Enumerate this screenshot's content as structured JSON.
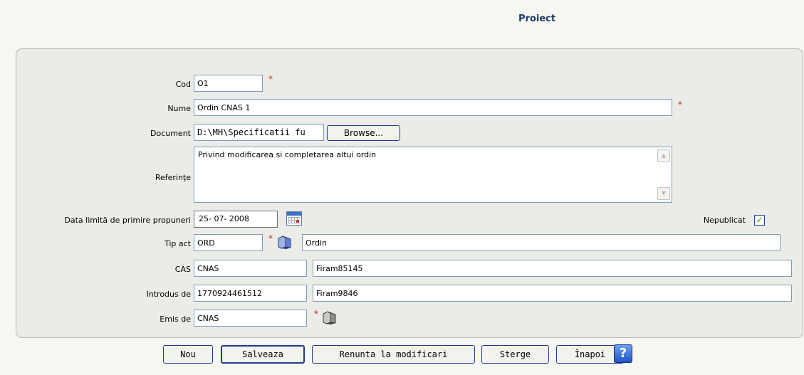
{
  "page": {
    "title": "Proiect"
  },
  "form": {
    "cod": {
      "label": "Cod",
      "value": "O1"
    },
    "nume": {
      "label": "Nume",
      "value": "Ordin CNAS 1"
    },
    "document": {
      "label": "Document",
      "value": "D:\\MH\\Specificatii fu",
      "browse_label": "Browse..."
    },
    "referinte": {
      "label": "Referinţe",
      "value": "Privind modificarea si completarea altui ordin"
    },
    "data_limita": {
      "label": "Data limită de primire propuneri",
      "value": "25- 07-  2008"
    },
    "nepublicat": {
      "label": "Nepublicat",
      "checked": true,
      "check_mark": "✓"
    },
    "tip_act": {
      "label": "Tip act",
      "code": "ORD",
      "name": "Ordin"
    },
    "cas": {
      "label": "CAS",
      "code": "CNAS",
      "name": "Firam85145"
    },
    "introdus_de": {
      "label": "Introdus de",
      "code": "1770924461512",
      "name": "Firam9846"
    },
    "emis_de": {
      "label": "Emis de",
      "code": "CNAS"
    },
    "required_marker": "*"
  },
  "buttons": {
    "nou": "Nou",
    "salveaza": "Salveaza",
    "renunta": "Renunta la modificari",
    "sterge": "Sterge",
    "inapoi": "Înapoi",
    "help": "?"
  },
  "icons": {
    "calendar": "calendar-icon",
    "folder": "folder-icon",
    "help": "help-icon",
    "scroll_up": "▲",
    "scroll_down": "▼"
  },
  "colors": {
    "title": "#1c3a6b",
    "required": "#d42020",
    "button_border": "#1d3d8a",
    "panel": "#ebebe8"
  }
}
